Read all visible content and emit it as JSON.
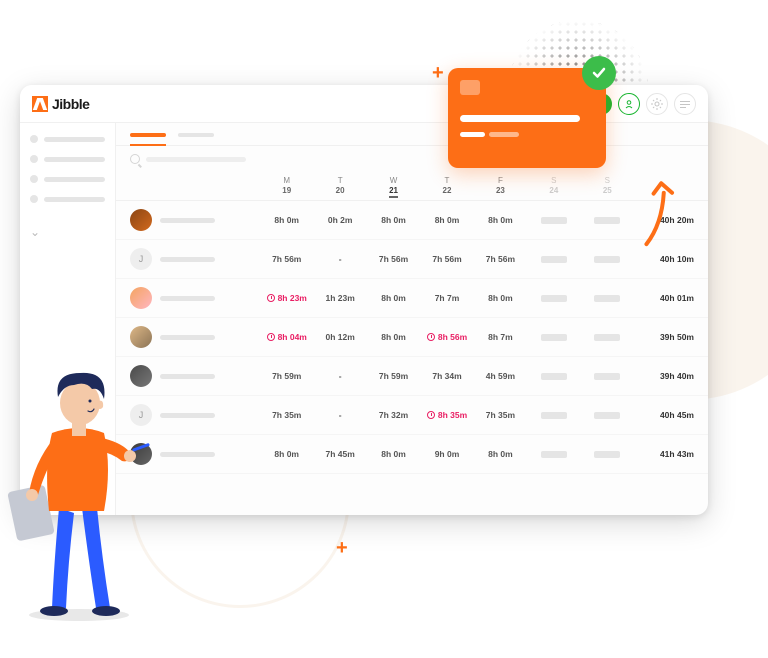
{
  "logo": "Jibble",
  "header": {
    "days": [
      {
        "label": "M",
        "date": "19"
      },
      {
        "label": "T",
        "date": "20"
      },
      {
        "label": "W",
        "date": "21",
        "today": true
      },
      {
        "label": "T",
        "date": "22"
      },
      {
        "label": "F",
        "date": "23"
      },
      {
        "label": "S",
        "date": "24",
        "muted": true
      },
      {
        "label": "S",
        "date": "25",
        "muted": true
      }
    ]
  },
  "rows": [
    {
      "avatar": "av1",
      "cells": [
        {
          "v": "8h 0m"
        },
        {
          "v": "0h 2m"
        },
        {
          "v": "8h 0m"
        },
        {
          "v": "8h 0m"
        },
        {
          "v": "8h 0m"
        }
      ],
      "total": "40h 20m"
    },
    {
      "avatar": "av2",
      "letter": "J",
      "cells": [
        {
          "v": "7h 56m"
        },
        {
          "v": "-"
        },
        {
          "v": "7h 56m"
        },
        {
          "v": "7h 56m"
        },
        {
          "v": "7h 56m"
        }
      ],
      "total": "40h 10m"
    },
    {
      "avatar": "av3",
      "cells": [
        {
          "v": "8h 23m",
          "warn": true
        },
        {
          "v": "1h 23m"
        },
        {
          "v": "8h 0m"
        },
        {
          "v": "7h 7m"
        },
        {
          "v": "8h 0m"
        }
      ],
      "total": "40h 01m"
    },
    {
      "avatar": "av4",
      "cells": [
        {
          "v": "8h 04m",
          "warn": true
        },
        {
          "v": "0h 12m"
        },
        {
          "v": "8h 0m"
        },
        {
          "v": "8h 56m",
          "warn": true
        },
        {
          "v": "8h 7m"
        }
      ],
      "total": "39h 50m"
    },
    {
      "avatar": "av5",
      "cells": [
        {
          "v": "7h 59m"
        },
        {
          "v": "-"
        },
        {
          "v": "7h 59m"
        },
        {
          "v": "7h 34m"
        },
        {
          "v": "4h 59m"
        }
      ],
      "total": "39h 40m"
    },
    {
      "avatar": "av6",
      "letter": "J",
      "cells": [
        {
          "v": "7h 35m"
        },
        {
          "v": "-"
        },
        {
          "v": "7h 32m"
        },
        {
          "v": "8h 35m",
          "warn": true
        },
        {
          "v": "7h 35m"
        }
      ],
      "total": "40h 45m"
    },
    {
      "avatar": "av7",
      "cells": [
        {
          "v": "8h 0m"
        },
        {
          "v": "7h 45m"
        },
        {
          "v": "8h 0m"
        },
        {
          "v": "9h 0m"
        },
        {
          "v": "8h 0m"
        }
      ],
      "total": "41h 43m"
    }
  ]
}
